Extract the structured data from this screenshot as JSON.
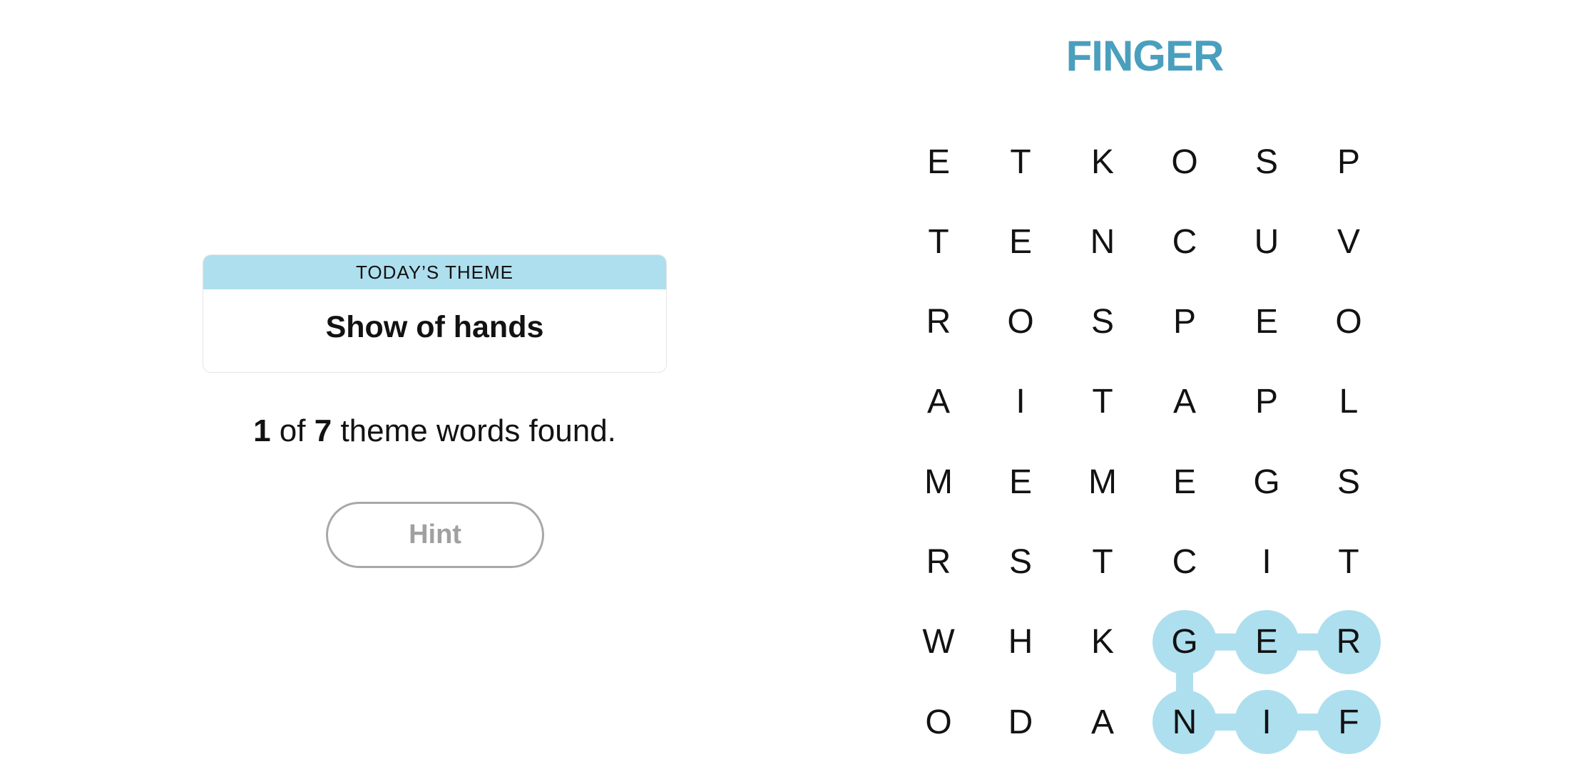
{
  "theme": {
    "header": "TODAY’S THEME",
    "title": "Show of hands"
  },
  "status": {
    "found": "1",
    "of_label": " of ",
    "total": "7",
    "suffix": " theme words found."
  },
  "hint_button": {
    "label": "Hint",
    "enabled": false
  },
  "current_word": "FINGER",
  "colors": {
    "highlight": "#aedfee",
    "accent_text": "#4a9fbe"
  },
  "grid": [
    [
      "E",
      "T",
      "K",
      "O",
      "S",
      "P"
    ],
    [
      "T",
      "E",
      "N",
      "C",
      "U",
      "V"
    ],
    [
      "R",
      "O",
      "S",
      "P",
      "E",
      "O"
    ],
    [
      "A",
      "I",
      "T",
      "A",
      "P",
      "L"
    ],
    [
      "M",
      "E",
      "M",
      "E",
      "G",
      "S"
    ],
    [
      "R",
      "S",
      "T",
      "C",
      "I",
      "T"
    ],
    [
      "W",
      "H",
      "K",
      "G",
      "E",
      "R"
    ],
    [
      "O",
      "D",
      "A",
      "N",
      "I",
      "F"
    ]
  ],
  "selected_path": [
    [
      7,
      5
    ],
    [
      7,
      4
    ],
    [
      7,
      3
    ],
    [
      6,
      3
    ],
    [
      6,
      4
    ],
    [
      6,
      5
    ]
  ]
}
